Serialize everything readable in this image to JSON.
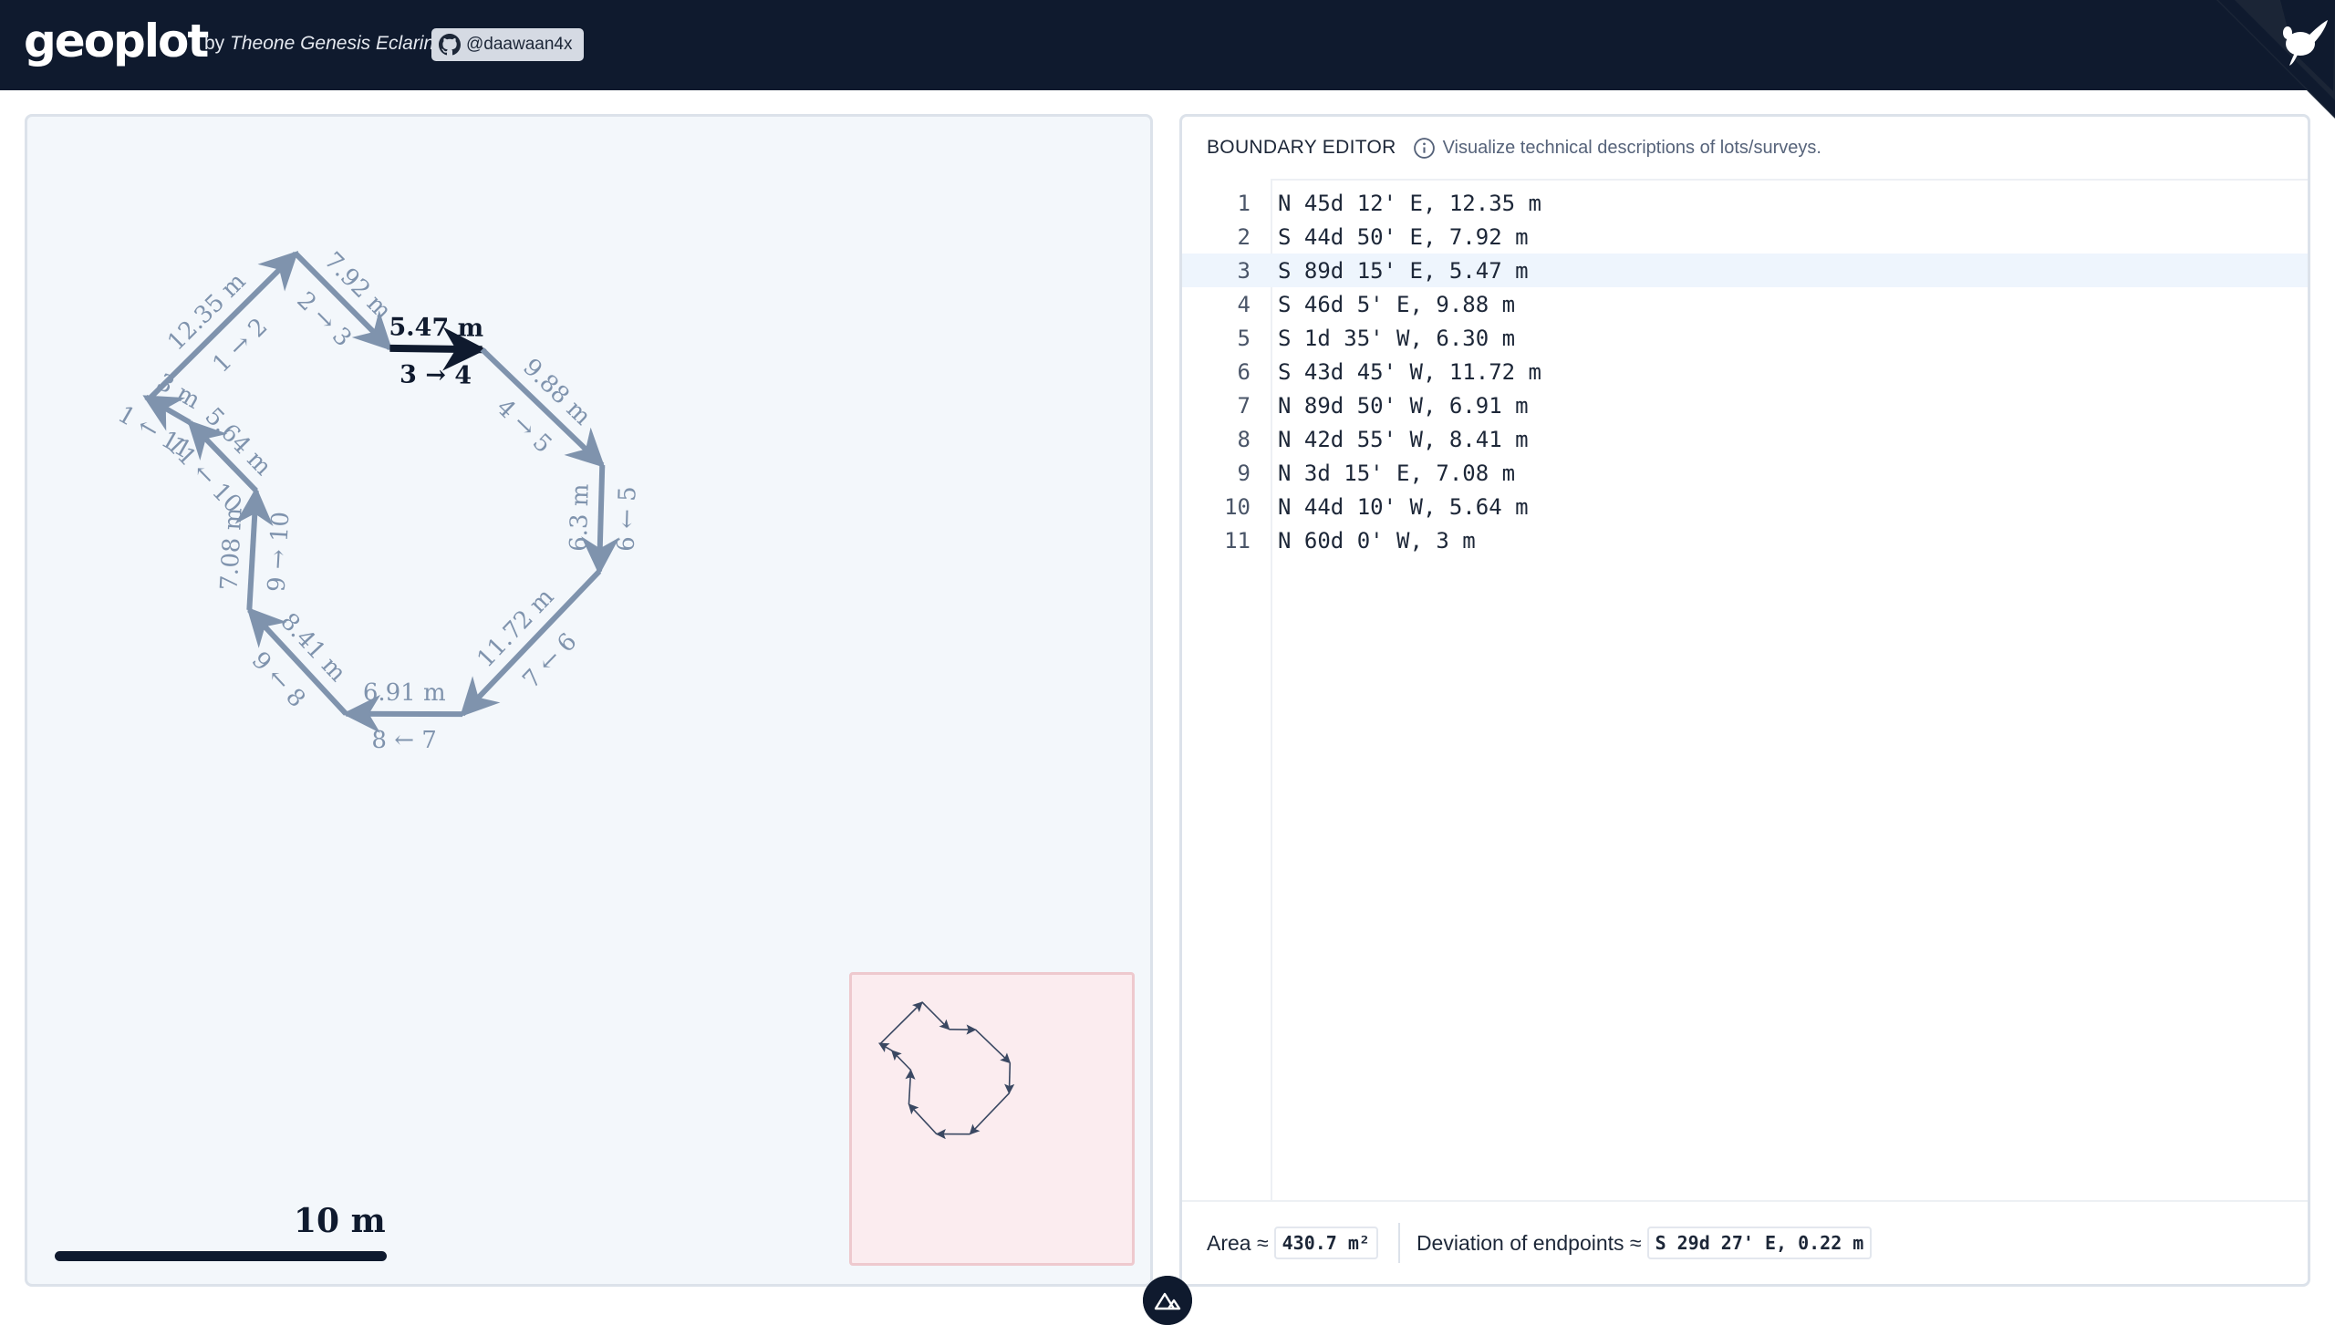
{
  "app": {
    "logo": "geoplot",
    "byline_prefix": "by",
    "author": "Theone Genesis Eclarin",
    "github_handle": "@daawaan4x"
  },
  "map": {
    "scale_label": "10 m",
    "segments": [
      {
        "length": "12.35 m",
        "index": "1 → 2"
      },
      {
        "length": "7.92 m",
        "index": "2 → 3"
      },
      {
        "length": "5.47 m",
        "index": "3 → 4"
      },
      {
        "length": "9.88 m",
        "index": "4 → 5"
      },
      {
        "length": "6.3 m",
        "index": "6 ← 5"
      },
      {
        "length": "11.72 m",
        "index": "7 ← 6"
      },
      {
        "length": "6.91 m",
        "index": "8 ← 7"
      },
      {
        "length": "8.41 m",
        "index": "9 ← 8"
      },
      {
        "length": "7.08 m",
        "index": "9 → 10"
      },
      {
        "length": "5.64 m",
        "index": "11 ← 10"
      },
      {
        "length": "3 m",
        "index": "1 ← 11"
      }
    ],
    "active_segment": 3,
    "colors": {
      "segment": "#7f93ad",
      "active": "#0f1a2e",
      "minimap_bg": "#fceaec"
    }
  },
  "editor": {
    "title": "BOUNDARY EDITOR",
    "hint": "Visualize technical descriptions of lots/surveys.",
    "active_line": 3,
    "lines": [
      "N 45d 12' E, 12.35 m",
      "S 44d 50' E, 7.92 m",
      "S 89d 15' E, 5.47 m",
      "S 46d 5' E, 9.88 m",
      "S 1d 35' W, 6.30 m",
      "S 43d 45' W, 11.72 m",
      "N 89d 50' W, 6.91 m",
      "N 42d 55' W, 8.41 m",
      "N 3d 15' E, 7.08 m",
      "N 44d 10' W, 5.64 m",
      "N 60d 0' W, 3 m"
    ]
  },
  "footer": {
    "area_label": "Area ≈",
    "area_value": "430.7 m²",
    "deviation_label": "Deviation of endpoints ≈",
    "deviation_value": "S 29d 27' E, 0.22 m"
  },
  "icons": [
    "github-icon",
    "info-icon",
    "nuxt-icon",
    "corner-mascot-icon"
  ]
}
